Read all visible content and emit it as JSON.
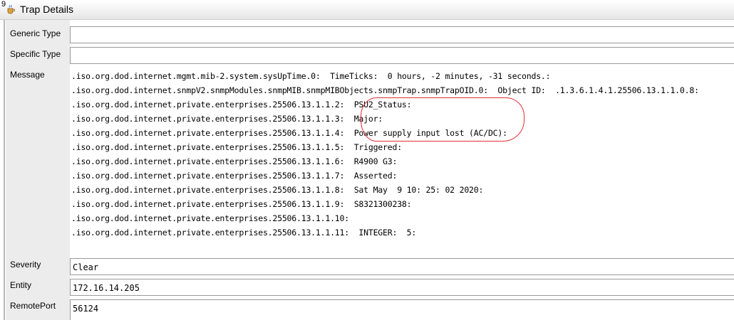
{
  "window": {
    "corner_text": "9",
    "title": "Trap Details",
    "icon": "java-cup-icon"
  },
  "fields": {
    "generic_type": {
      "label": "Generic Type",
      "value": ""
    },
    "specific_type": {
      "label": "Specific Type",
      "value": ""
    },
    "message": {
      "label": "Message"
    },
    "severity": {
      "label": "Severity",
      "value": "Clear"
    },
    "entity": {
      "label": "Entity",
      "value": "172.16.14.205"
    },
    "remote_port": {
      "label": "RemotePort",
      "value": "56124"
    }
  },
  "message_lines": [
    ".iso.org.dod.internet.mgmt.mib-2.system.sysUpTime.0:  TimeTicks:  0 hours, -2 minutes, -31 seconds.:",
    ".iso.org.dod.internet.snmpV2.snmpModules.snmpMIB.snmpMIBObjects.snmpTrap.snmpTrapOID.0:  Object ID:  .1.3.6.1.4.1.25506.13.1.1.0.8:",
    ".iso.org.dod.internet.private.enterprises.25506.13.1.1.2:  PSU2_Status:",
    ".iso.org.dod.internet.private.enterprises.25506.13.1.1.3:  Major:",
    ".iso.org.dod.internet.private.enterprises.25506.13.1.1.4:  Power supply input lost (AC/DC):",
    ".iso.org.dod.internet.private.enterprises.25506.13.1.1.5:  Triggered:",
    ".iso.org.dod.internet.private.enterprises.25506.13.1.1.6:  R4900 G3:",
    ".iso.org.dod.internet.private.enterprises.25506.13.1.1.7:  Asserted:",
    ".iso.org.dod.internet.private.enterprises.25506.13.1.1.8:  Sat May  9 10: 25: 02 2020:",
    ".iso.org.dod.internet.private.enterprises.25506.13.1.1.9:  S8321300238:",
    ".iso.org.dod.internet.private.enterprises.25506.13.1.1.10:",
    ".iso.org.dod.internet.private.enterprises.25506.13.1.1.11:  INTEGER:  5:"
  ],
  "annotation": {
    "color": "#e0303a",
    "shape": "oval-around-psu-status-lines"
  }
}
